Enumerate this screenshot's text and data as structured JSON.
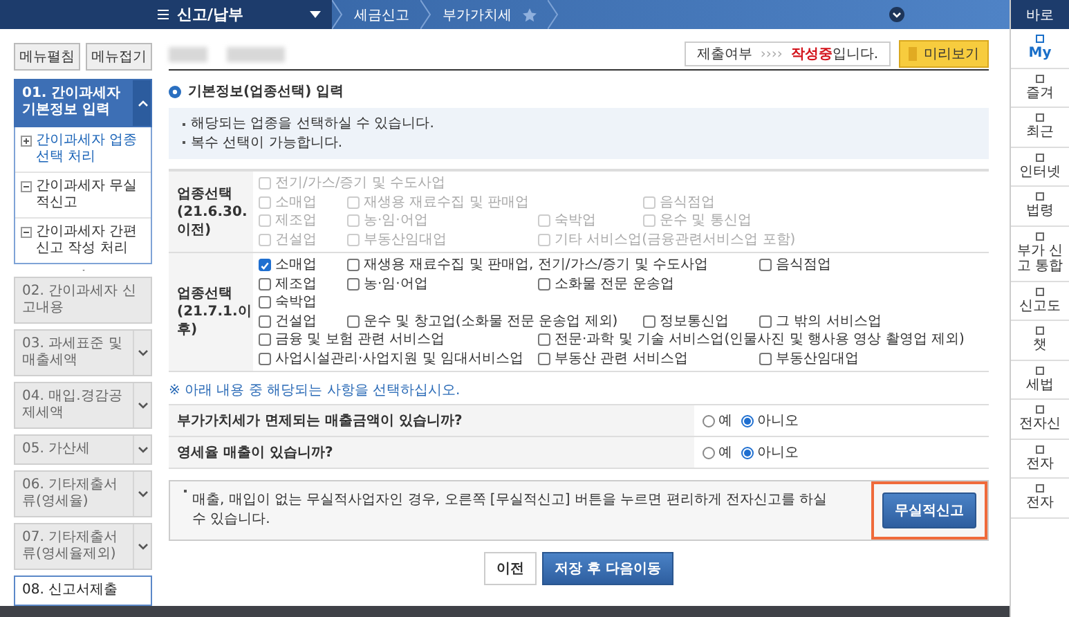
{
  "topbar": {
    "menu_title": "신고/납부",
    "breadcrumb": [
      "세금신고",
      "부가가치세"
    ]
  },
  "quick_menu": {
    "title": "바로",
    "items": [
      {
        "text": "My",
        "highlight": true
      },
      {
        "text": "즐겨",
        "highlight": false
      },
      {
        "text": "최근",
        "highlight": false
      },
      {
        "text": "인터넷",
        "highlight": false
      },
      {
        "text": "법령",
        "highlight": false
      },
      {
        "text": "부가 신고 통합",
        "highlight": false
      },
      {
        "text": "신고도",
        "highlight": false
      },
      {
        "text": "챗",
        "highlight": false
      },
      {
        "text": "세법",
        "highlight": false
      },
      {
        "text": "전자신",
        "highlight": false
      },
      {
        "text": "전자",
        "highlight": false
      },
      {
        "text": "전자",
        "highlight": false
      }
    ]
  },
  "sidebar": {
    "buttons": [
      "메뉴펼침",
      "메뉴접기"
    ],
    "items": [
      {
        "label": "01. 간이과세자 기본정보 입력",
        "selected": true,
        "disabled": false,
        "expandable": true,
        "expanded": true,
        "children": [
          {
            "label": "간이과세자 업종선택 처리",
            "kind": "plus",
            "selected": true
          },
          {
            "label": "간이과세자 무실적신고",
            "kind": "minus",
            "selected": false
          },
          {
            "label": "간이과세자 간편신고 작성 처리",
            "kind": "minus",
            "selected": false
          }
        ]
      },
      {
        "label": "02. 간이과세자 신고내용",
        "selected": false,
        "disabled": true,
        "expandable": false,
        "expanded": false
      },
      {
        "label": "03. 과세표준 및 매출세액",
        "selected": false,
        "disabled": true,
        "expandable": true,
        "expanded": false
      },
      {
        "label": "04. 매입.경감공제세액",
        "selected": false,
        "disabled": true,
        "expandable": true,
        "expanded": false
      },
      {
        "label": "05. 가산세",
        "selected": false,
        "disabled": true,
        "expandable": true,
        "expanded": false
      },
      {
        "label": "06. 기타제출서류(영세율)",
        "selected": false,
        "disabled": true,
        "expandable": true,
        "expanded": false
      },
      {
        "label": "07. 기타제출서류(영세율제외)",
        "selected": false,
        "disabled": true,
        "expandable": true,
        "expanded": false
      },
      {
        "label": "08. 신고서제출",
        "selected": false,
        "disabled": false,
        "expandable": false,
        "expanded": false
      }
    ]
  },
  "status": {
    "label": "제출여부",
    "arrows": "››››",
    "text": "**작성중**입니다.",
    "preview_button": "미리보기"
  },
  "section_title": "기본정보(업종선택) 입력",
  "notes": [
    "해당되는 업종을 선택하실 수 있습니다.",
    "복수 선택이 가능합니다."
  ],
  "industry_tables": [
    {
      "title": "업종선택",
      "period": "(21.6.30.이전)",
      "rows": [
        [
          {
            "label": "전기/가스/증기 및 수도사업",
            "checked": false,
            "disabled": true
          }
        ],
        [
          {
            "label": "소매업",
            "checked": false,
            "disabled": true
          },
          {
            "label": "재생용 재료수집 및 판매업",
            "checked": false,
            "disabled": true
          },
          "",
          {
            "label": "음식점업",
            "checked": false,
            "disabled": true
          }
        ],
        [
          {
            "label": "제조업",
            "checked": false,
            "disabled": true
          },
          {
            "label": "농·임·어업",
            "checked": false,
            "disabled": true
          },
          {
            "label": "숙박업",
            "checked": false,
            "disabled": true
          },
          {
            "label": "운수 및 통신업",
            "checked": false,
            "disabled": true
          }
        ],
        [
          {
            "label": "건설업",
            "checked": false,
            "disabled": true
          },
          {
            "label": "부동산임대업",
            "checked": false,
            "disabled": true
          },
          {
            "label": "기타 서비스업(금융관련서비스업 포함)",
            "checked": false,
            "disabled": true
          }
        ]
      ]
    },
    {
      "title": "업종선택",
      "period": "(21.7.1.이후)",
      "rows": [
        [
          {
            "label": "소매업",
            "checked": true,
            "disabled": false
          },
          {
            "label": "재생용 재료수집 및 판매업, 전기/가스/증기 및 수도사업",
            "checked": false,
            "disabled": false
          },
          "",
          "",
          {
            "label": "음식점업",
            "checked": false,
            "disabled": false
          }
        ],
        [
          {
            "label": "제조업",
            "checked": false,
            "disabled": false
          },
          {
            "label": "농·임·어업",
            "checked": false,
            "disabled": false
          },
          {
            "label": "소화물 전문 운송업",
            "checked": false,
            "disabled": false
          }
        ],
        [
          {
            "label": "숙박업",
            "checked": false,
            "disabled": false
          }
        ],
        [
          {
            "label": "건설업",
            "checked": false,
            "disabled": false
          },
          {
            "label": "운수 및 창고업(소화물 전문 운송업 제외)",
            "checked": false,
            "disabled": false
          },
          "",
          {
            "label": "정보통신업",
            "checked": false,
            "disabled": false
          },
          {
            "label": "그 밖의 서비스업",
            "checked": false,
            "disabled": false
          }
        ],
        [
          {
            "label": "금융 및 보험 관련 서비스업",
            "checked": false,
            "disabled": false
          },
          "",
          {
            "label": "전문·과학 및 기술 서비스업(인물사진 및 행사용 영상 촬영업 제외)",
            "checked": false,
            "disabled": false
          }
        ],
        [
          {
            "label": "사업시설관리·사업지원 및 임대서비스업",
            "checked": false,
            "disabled": false
          },
          "",
          {
            "label": "부동산 관련 서비스업",
            "checked": false,
            "disabled": false
          },
          "",
          {
            "label": "부동산임대업",
            "checked": false,
            "disabled": false
          }
        ]
      ]
    }
  ],
  "question_notice": "※ 아래 내용 중 해당되는 사항을 선택하십시오.",
  "questions": [
    {
      "text": "부가가치세가 면제되는 매출금액이 있습니까?",
      "options": [
        {
          "label": "예",
          "selected": false
        },
        {
          "label": "아니오",
          "selected": true
        }
      ]
    },
    {
      "text": "영세율 매출이 있습니까?",
      "options": [
        {
          "label": "예",
          "selected": false
        },
        {
          "label": "아니오",
          "selected": true
        }
      ]
    }
  ],
  "no_record": {
    "text": "매출, 매입이 없는 무실적사업자인 경우, 오른쪽 [무실적신고] 버튼을 누르면 편리하게 전자신고를 하실 수 있습니다.",
    "button": "무실적신고",
    "highlighted": true
  },
  "footer_buttons": [
    {
      "label": "이전",
      "primary": false
    },
    {
      "label": "저장 후 다음이동",
      "primary": true
    }
  ]
}
